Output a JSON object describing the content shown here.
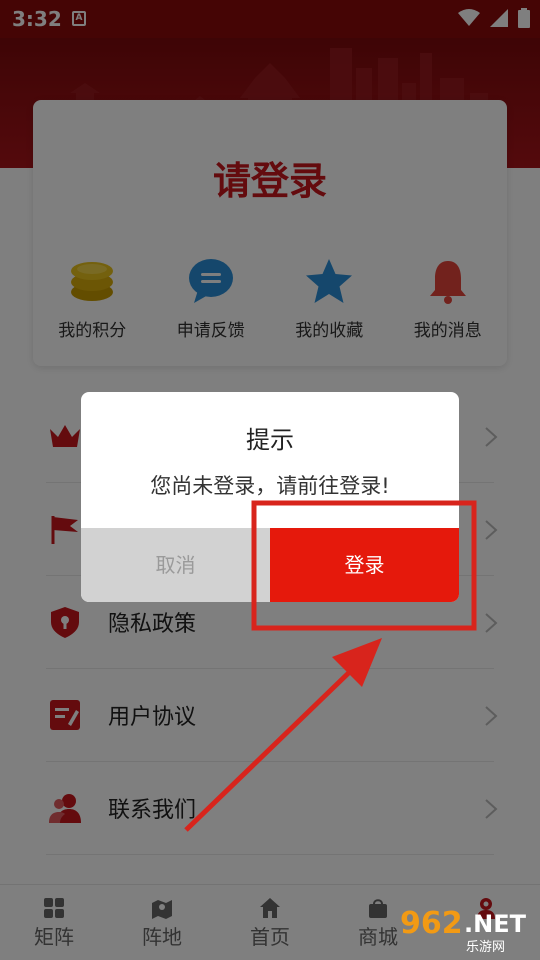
{
  "status_bar": {
    "time": "3:32",
    "a_badge": "A"
  },
  "login_card": {
    "title": "请登录",
    "quick_items": [
      {
        "label": "我的积分",
        "icon": "coins-icon",
        "color": "#d2a400"
      },
      {
        "label": "申请反馈",
        "icon": "chat-bubble-icon",
        "color": "#2a8fd8"
      },
      {
        "label": "我的收藏",
        "icon": "star-icon",
        "color": "#2a8fd8"
      },
      {
        "label": "我的消息",
        "icon": "bell-icon",
        "color": "#e5453a"
      }
    ]
  },
  "menu": [
    {
      "label": "",
      "icon": "crown-icon"
    },
    {
      "label": "",
      "icon": "flag-icon"
    },
    {
      "label": "隐私政策",
      "icon": "shield-icon"
    },
    {
      "label": "用户协议",
      "icon": "edit-document-icon"
    },
    {
      "label": "联系我们",
      "icon": "contacts-icon"
    }
  ],
  "tabbar": [
    {
      "label": "矩阵",
      "icon": "grid-icon"
    },
    {
      "label": "阵地",
      "icon": "map-icon"
    },
    {
      "label": "首页",
      "icon": "home-icon"
    },
    {
      "label": "商城",
      "icon": "bag-icon"
    },
    {
      "label": "",
      "icon": "user-icon"
    }
  ],
  "dialog": {
    "title": "提示",
    "message": "您尚未登录，请前往登录!",
    "cancel_label": "取消",
    "ok_label": "登录"
  },
  "watermark": {
    "number": "962",
    "domain": ".NET",
    "sub": "乐游网"
  },
  "colors": {
    "brand_red": "#c8161d",
    "button_red": "#e5190c",
    "annotation_red": "#d8241c"
  }
}
